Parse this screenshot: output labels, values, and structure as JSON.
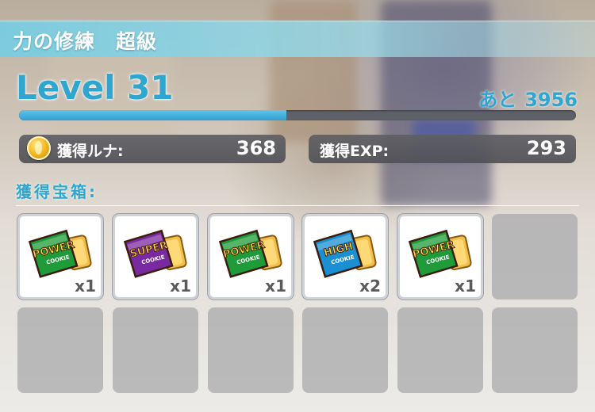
{
  "screen": {
    "title": "力の修練　超級",
    "level_text": "Level 31",
    "remaining_label": "あと",
    "remaining_value": "3956",
    "xp_progress": 0.48
  },
  "stats": {
    "luna_label": "獲得ルナ:",
    "luna_value": "368",
    "exp_label": "獲得EXP:",
    "exp_value": "293",
    "coin_icon": "luna-coin-icon"
  },
  "rewards": {
    "label": "獲得宝箱:",
    "items": [
      {
        "name": "power-cookie",
        "label": "POWER",
        "sub": "COOKIE",
        "qty": "x1",
        "color": "#1f9b3a"
      },
      {
        "name": "super-cookie",
        "label": "SUPER",
        "sub": "COOKIE",
        "qty": "x1",
        "color": "#7a2aa0"
      },
      {
        "name": "power-cookie",
        "label": "POWER",
        "sub": "COOKIE",
        "qty": "x1",
        "color": "#1f9b3a"
      },
      {
        "name": "high-cookie",
        "label": "HIGH",
        "sub": "COOKIE",
        "qty": "x2",
        "color": "#1a8fd1"
      },
      {
        "name": "power-cookie",
        "label": "POWER",
        "sub": "COOKIE",
        "qty": "x1",
        "color": "#1f9b3a"
      }
    ],
    "total_slots": 12
  }
}
